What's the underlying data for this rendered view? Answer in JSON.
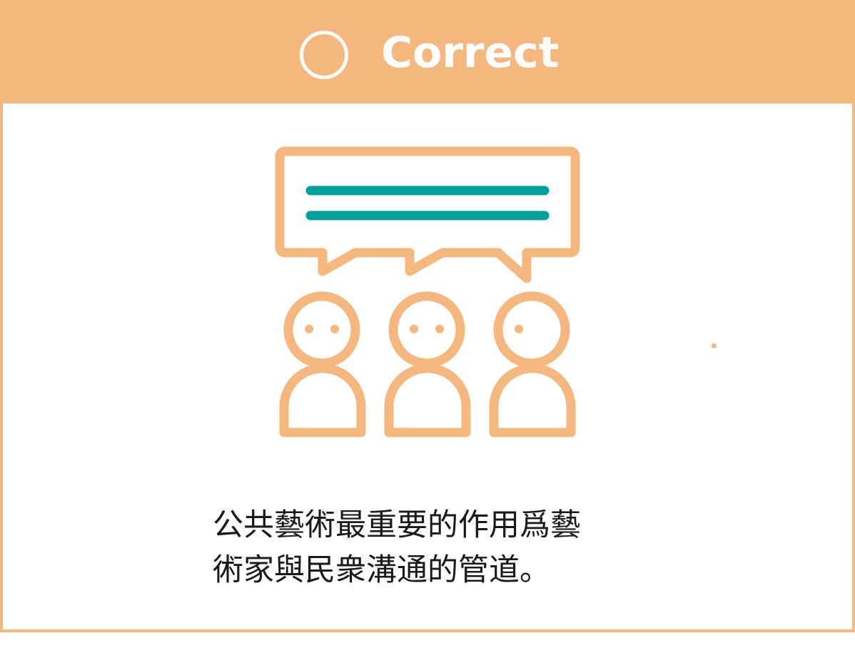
{
  "header": {
    "symbol": "circle-mark-icon",
    "title": "Correct"
  },
  "illustration": {
    "icon": "people-discussion-icon",
    "bubble_icon": "speech-bubble-icon",
    "person_count": 3
  },
  "statement": {
    "line1": "公共藝術最重要的作用爲藝",
    "line2": "術家與民衆溝通的管道。"
  },
  "colors": {
    "accent": "#f6b77e",
    "teal": "#00a19a",
    "text": "#1a1a1a",
    "background": "#ffffff"
  }
}
